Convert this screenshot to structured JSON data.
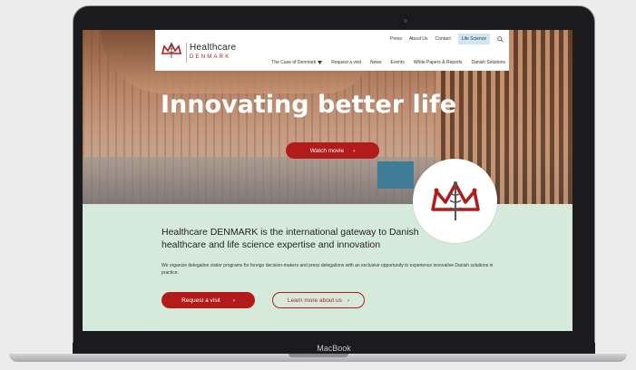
{
  "nav": {
    "logo_line1": "Healthcare",
    "logo_line2": "DENMARK",
    "top_links": [
      "Press",
      "About Us",
      "Contact",
      "Life Science"
    ],
    "main_links": [
      "The Case of Denmark",
      "Request a visit",
      "News",
      "Events",
      "White Papers & Reports",
      "Danish Solutions"
    ]
  },
  "hero": {
    "title": "Innovating better life",
    "watch_label": "Watch movie",
    "arrow": "›"
  },
  "intro": {
    "heading": "Healthcare DENMARK is the international gateway to Danish healthcare and life science expertise and innovation",
    "paragraph": "We organize delegation visitor programs for foreign decision-makers and press delegations with an exclusive opportunity to experience innovative Danish solutions in practice.",
    "request_label": "Request a visit",
    "learn_label": "Learn more about us"
  },
  "device": {
    "label": "MacBook"
  },
  "colors": {
    "brand_red": "#b31b1b",
    "green_bg": "#d6eadb",
    "active_tab": "#cfe7f3"
  }
}
